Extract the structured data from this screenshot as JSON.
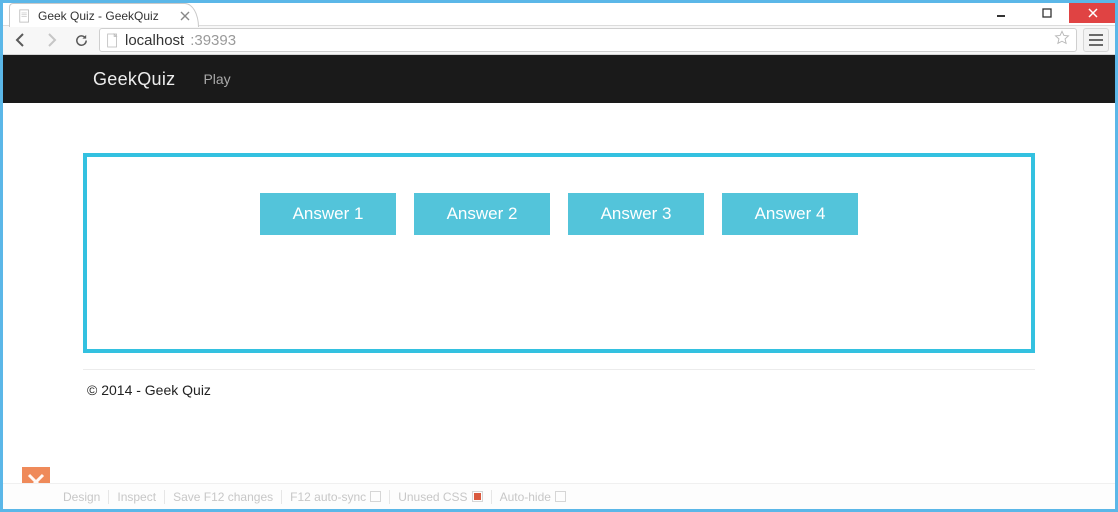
{
  "window": {
    "tab_title": "Geek Quiz - GeekQuiz",
    "url_host": "localhost",
    "url_port": ":39393"
  },
  "site": {
    "brand": "GeekQuiz",
    "nav": {
      "play": "Play"
    }
  },
  "quiz": {
    "answers": [
      "Answer 1",
      "Answer 2",
      "Answer 3",
      "Answer 4"
    ]
  },
  "footer": {
    "copyright": "© 2014 - Geek Quiz"
  },
  "devbar": {
    "design": "Design",
    "inspect": "Inspect",
    "save": "Save F12 changes",
    "autosync": "F12 auto-sync",
    "unused": "Unused CSS",
    "autohide": "Auto-hide"
  }
}
